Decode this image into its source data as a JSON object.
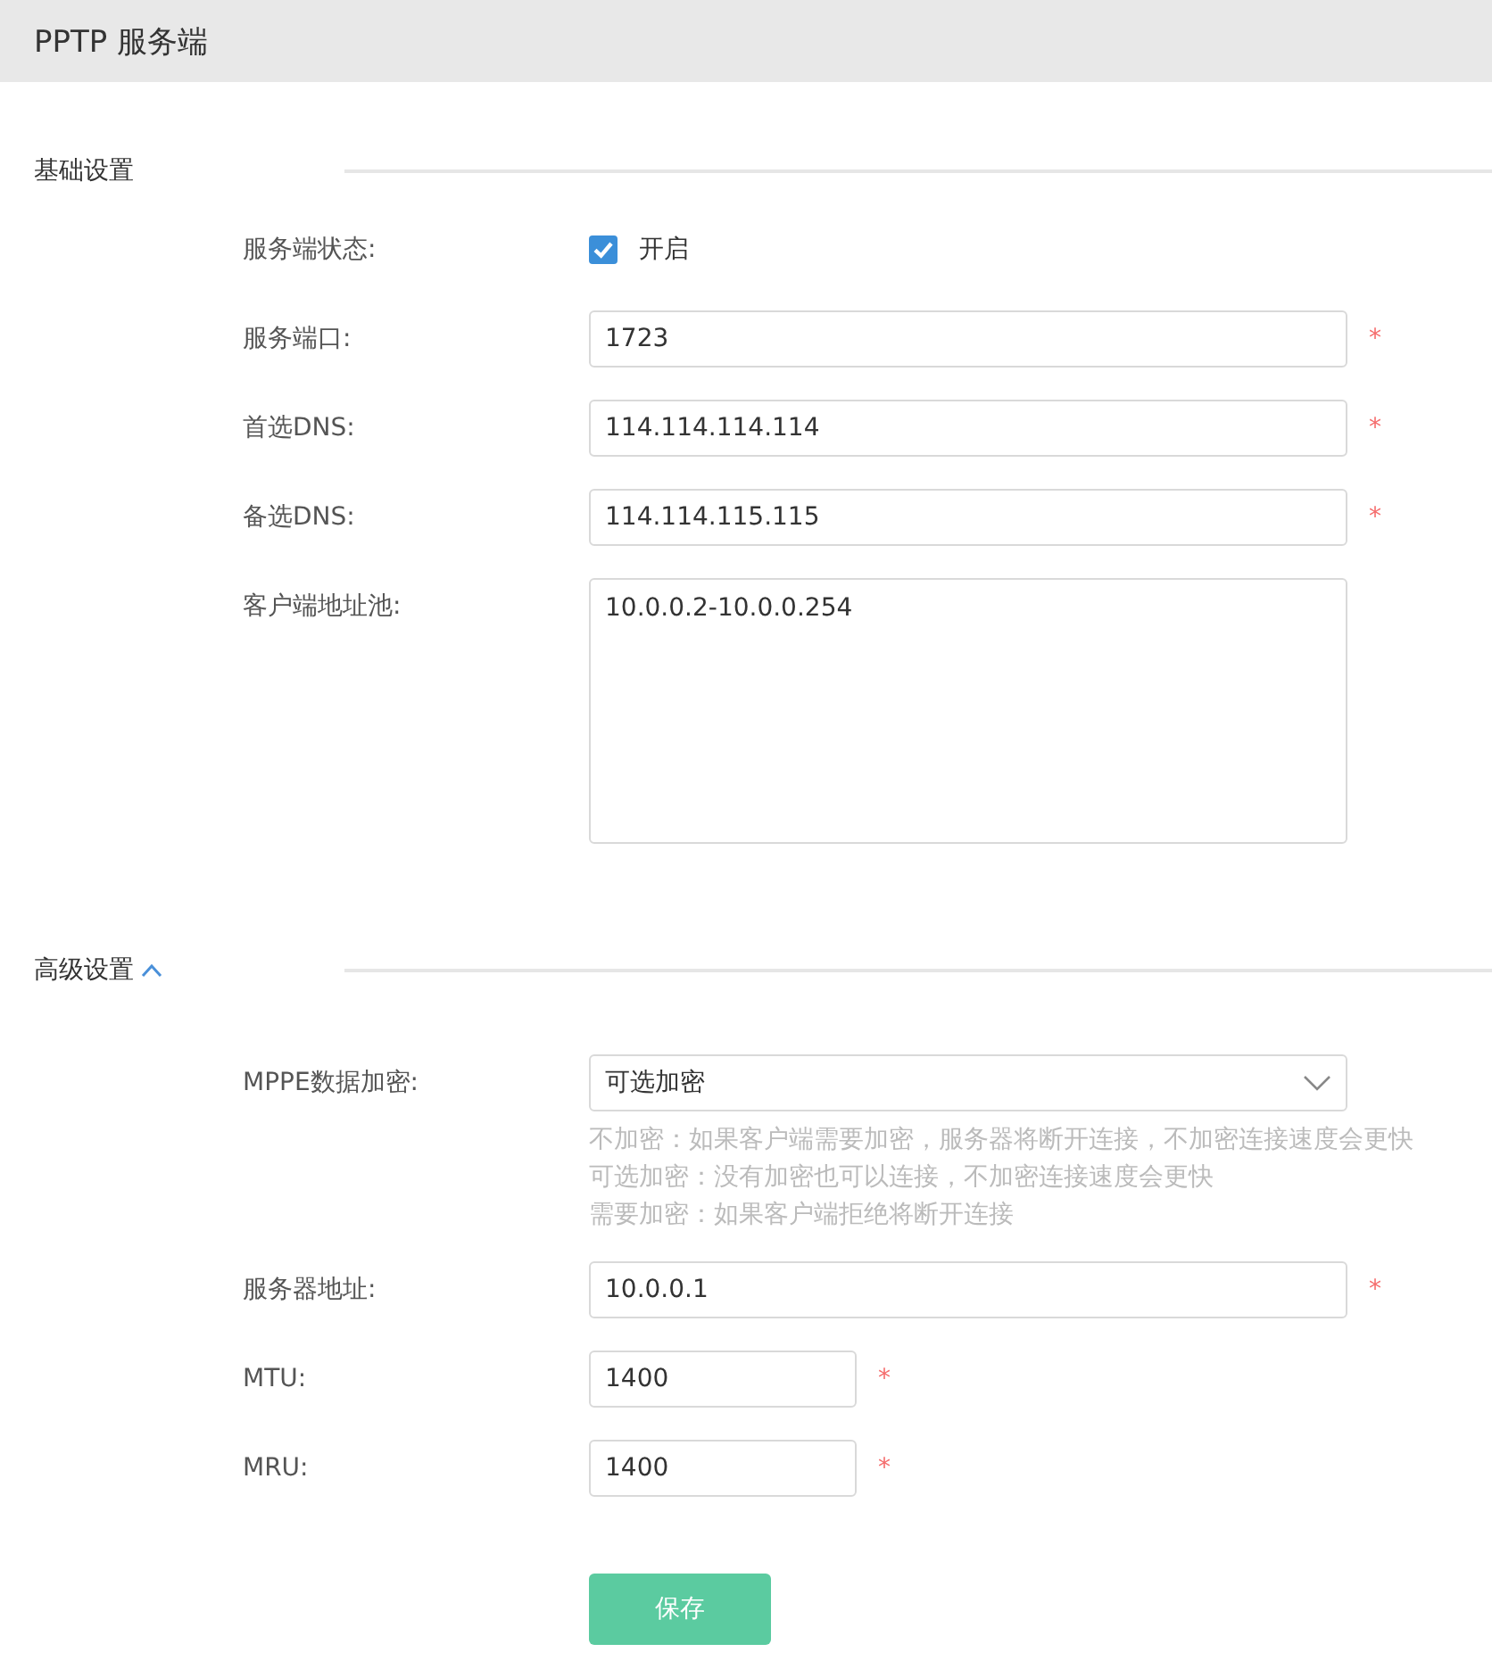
{
  "header": {
    "title": "PPTP 服务端"
  },
  "basic": {
    "title": "基础设置",
    "fields": [
      {
        "label": "服务端状态:",
        "kind": "checkbox",
        "checked": true,
        "option_label": "开启"
      },
      {
        "label": "服务端口:",
        "kind": "text",
        "value": "1723",
        "required_mark": "*"
      },
      {
        "label": "首选DNS:",
        "kind": "text",
        "value": "114.114.114.114",
        "required_mark": "*"
      },
      {
        "label": "备选DNS:",
        "kind": "text",
        "value": "114.114.115.115",
        "required_mark": "*"
      },
      {
        "label": "客户端地址池:",
        "kind": "textarea",
        "value": "10.0.0.2-10.0.0.254"
      }
    ]
  },
  "advanced": {
    "title": "高级设置",
    "expanded": true,
    "fields": [
      {
        "label": "MPPE数据加密:",
        "kind": "select",
        "value": "可选加密",
        "hints": [
          "不加密：如果客户端需要加密，服务器将断开连接，不加密连接速度会更快",
          "可选加密：没有加密也可以连接，不加密连接速度会更快",
          "需要加密：如果客户端拒绝将断开连接"
        ]
      },
      {
        "label": "服务器地址:",
        "kind": "text",
        "value": "10.0.0.1",
        "required_mark": "*"
      },
      {
        "label": "MTU:",
        "kind": "short",
        "value": "1400",
        "required_mark": "*"
      },
      {
        "label": "MRU:",
        "kind": "short",
        "value": "1400",
        "required_mark": "*"
      }
    ]
  },
  "save_button": "保存"
}
